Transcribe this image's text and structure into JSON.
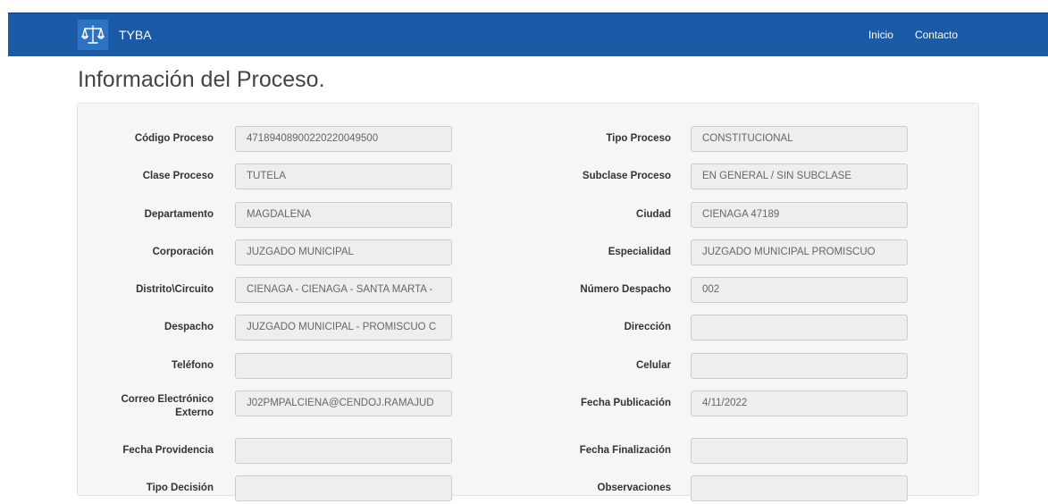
{
  "navbar": {
    "brand": "TYBA",
    "links": [
      "Inicio",
      "Contacto"
    ]
  },
  "page": {
    "title": "Información del Proceso."
  },
  "form": {
    "rows": [
      {
        "left_label": "Código Proceso",
        "left_value": "47189408900220220049500",
        "right_label": "Tipo Proceso",
        "right_value": "CONSTITUCIONAL"
      },
      {
        "left_label": "Clase Proceso",
        "left_value": "TUTELA",
        "right_label": "Subclase Proceso",
        "right_value": "EN GENERAL / SIN SUBCLASE"
      },
      {
        "left_label": "Departamento",
        "left_value": "MAGDALENA",
        "right_label": "Ciudad",
        "right_value": "CIENAGA 47189"
      },
      {
        "left_label": "Corporación",
        "left_value": "JUZGADO MUNICIPAL",
        "right_label": "Especialidad",
        "right_value": "JUZGADO MUNICIPAL  PROMISCUO"
      },
      {
        "left_label": "Distrito\\Circuito",
        "left_value": "CIENAGA - CIENAGA - SANTA MARTA -",
        "right_label": "Número Despacho",
        "right_value": "002"
      },
      {
        "left_label": "Despacho",
        "left_value": "JUZGADO MUNICIPAL - PROMISCUO C",
        "right_label": "Dirección",
        "right_value": ""
      },
      {
        "left_label": "Teléfono",
        "left_value": "",
        "right_label": "Celular",
        "right_value": ""
      },
      {
        "left_label": "Correo Electrónico Externo",
        "left_value": "J02PMPALCIENA@CENDOJ.RAMAJUD",
        "right_label": "Fecha Publicación",
        "right_value": "4/11/2022"
      },
      {
        "left_label": "Fecha Providencia",
        "left_value": "",
        "right_label": "Fecha Finalización",
        "right_value": ""
      },
      {
        "left_label": "Tipo Decisión",
        "left_value": "",
        "right_label": "Observaciones",
        "right_value": ""
      }
    ]
  }
}
